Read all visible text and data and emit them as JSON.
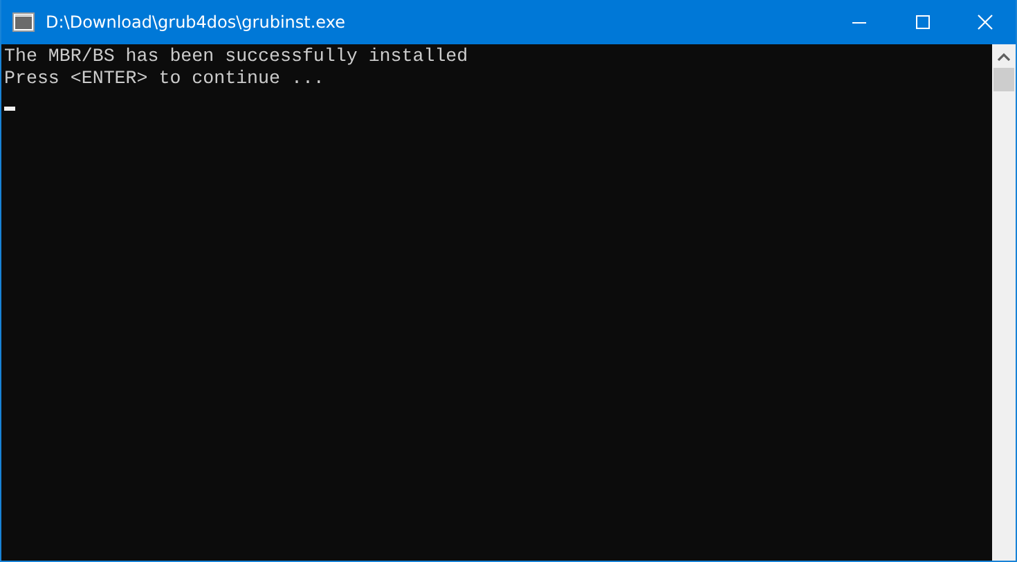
{
  "window": {
    "title": "D:\\Download\\grub4dos\\grubinst.exe"
  },
  "console": {
    "lines": [
      "The MBR/BS has been successfully installed",
      "Press <ENTER> to continue ..."
    ]
  }
}
